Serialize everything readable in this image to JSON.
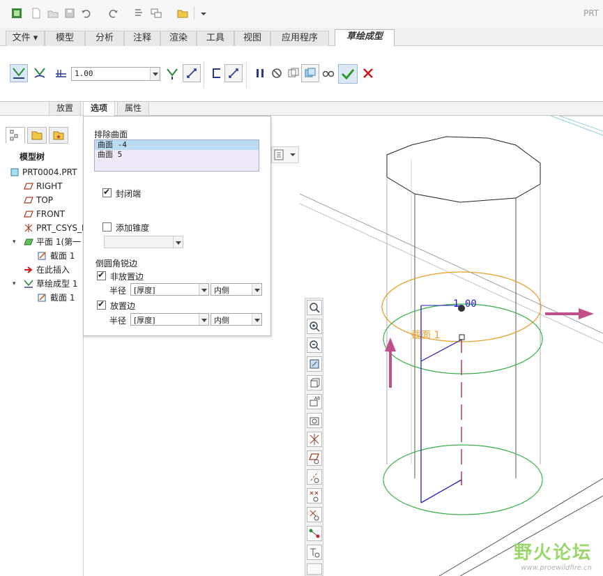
{
  "window": {
    "title": "PRT"
  },
  "ribbon_tabs": [
    {
      "label": "文件 ▾"
    },
    {
      "label": "模型"
    },
    {
      "label": "分析"
    },
    {
      "label": "注释"
    },
    {
      "label": "渲染"
    },
    {
      "label": "工具"
    },
    {
      "label": "视图"
    },
    {
      "label": "应用程序"
    },
    {
      "label": "草绘成型"
    }
  ],
  "ribbon": {
    "thickness_value": "1.00"
  },
  "panel_tabs": [
    {
      "label": "放置"
    },
    {
      "label": "选项"
    },
    {
      "label": "属性"
    }
  ],
  "tree": {
    "title": "模型树",
    "items": [
      {
        "label": "PRT0004.PRT"
      },
      {
        "label": "RIGHT"
      },
      {
        "label": "TOP"
      },
      {
        "label": "FRONT"
      },
      {
        "label": "PRT_CSYS_D"
      },
      {
        "label": "平面 1(第一"
      },
      {
        "label": "截面 1"
      },
      {
        "label": "在此插入"
      },
      {
        "label": "草绘成型 1"
      },
      {
        "label": "截面 1"
      }
    ],
    "expander": "▾"
  },
  "options": {
    "exclude_label": "排除曲面",
    "exclude_surfaces": [
      "曲面 -4",
      "曲面 5"
    ],
    "seal_ends_label": "封闭端",
    "seal_ends_checked": true,
    "add_draft_label": "添加锥度",
    "add_draft_checked": false,
    "round_label": "倒圆角锐边",
    "non_placement_label": "非放置边",
    "non_placement_checked": true,
    "placement_label": "放置边",
    "placement_checked": true,
    "radius_label": "半径",
    "radius_value_1": "[厚度]",
    "side_value_1": "内侧",
    "radius_value_2": "[厚度]",
    "side_value_2": "内侧"
  },
  "graphics": {
    "dimension_text": "1.00",
    "section_label": "截面 1",
    "watermark_cn": "野火论坛",
    "watermark_url": "www.proewildfire.cn"
  },
  "colors": {
    "accent_orange": "#e8a030",
    "sketch_green": "#38b048",
    "dim_blue": "#2020c0",
    "arrow_pink": "#c0508a",
    "confirm_green": "#2e9a2e",
    "cancel_red": "#d01818"
  }
}
